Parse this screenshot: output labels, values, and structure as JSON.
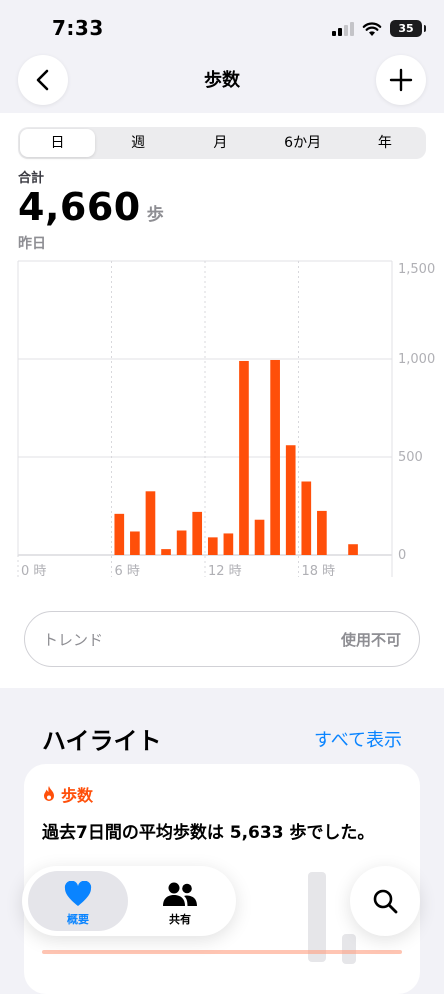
{
  "status": {
    "time": "7:33",
    "battery": "35"
  },
  "nav": {
    "title": "歩数"
  },
  "segments": [
    {
      "label": "日",
      "selected": true
    },
    {
      "label": "週",
      "selected": false
    },
    {
      "label": "月",
      "selected": false
    },
    {
      "label": "6か月",
      "selected": false
    },
    {
      "label": "年",
      "selected": false
    }
  ],
  "summary": {
    "label": "合計",
    "value": "4,660",
    "unit": "歩",
    "date": "昨日"
  },
  "trend": {
    "label": "トレンド",
    "status": "使用不可"
  },
  "highlights": {
    "title": "ハイライト",
    "see_all": "すべて表示",
    "card": {
      "category": "歩数",
      "text": "過去7日間の平均歩数は 5,633 歩でした。"
    }
  },
  "tabbar": {
    "summary_label": "概要",
    "sharing_label": "共有"
  },
  "colors": {
    "accent": "#ff4f0a",
    "link": "#0a84ff"
  },
  "chart_data": {
    "type": "bar",
    "x_unit": "hour",
    "x": [
      6,
      7,
      8,
      9,
      10,
      11,
      12,
      13,
      14,
      15,
      16,
      17,
      18,
      19,
      21
    ],
    "values": [
      210,
      120,
      325,
      30,
      125,
      220,
      90,
      110,
      990,
      180,
      995,
      560,
      375,
      225,
      55
    ],
    "xlim": [
      0,
      24
    ],
    "ylim": [
      0,
      1500
    ],
    "x_ticks": [
      {
        "x": 0,
        "label": "0 時"
      },
      {
        "x": 6,
        "label": "6 時"
      },
      {
        "x": 12,
        "label": "12 時"
      },
      {
        "x": 18,
        "label": "18 時"
      }
    ],
    "y_ticks": [
      {
        "y": 0,
        "label": "0"
      },
      {
        "y": 500,
        "label": "500"
      },
      {
        "y": 1000,
        "label": "1,000"
      },
      {
        "y": 1500,
        "label": "1,500"
      }
    ],
    "grid": true,
    "color": "#ff4f0a"
  }
}
